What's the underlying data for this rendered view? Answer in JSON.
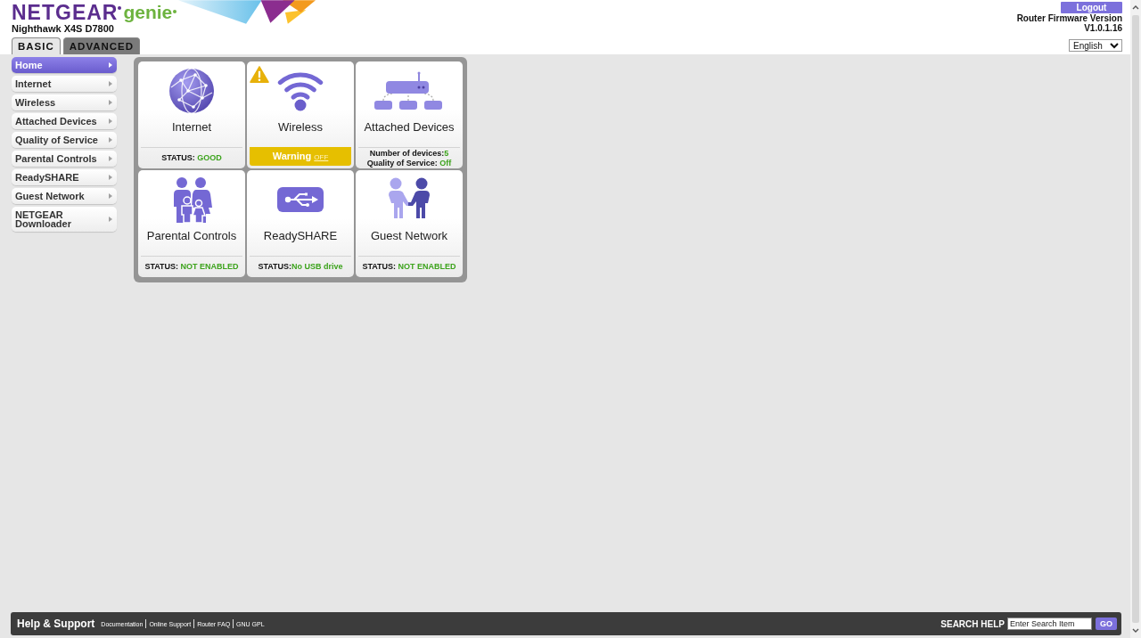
{
  "header": {
    "brand": "NETGEAR",
    "product": "genie",
    "model": "Nighthawk X4S D7800",
    "logout": "Logout",
    "firmware_label": "Router Firmware Version",
    "firmware_version": "V1.0.1.16",
    "language": "English"
  },
  "tabs": [
    {
      "label": "BASIC",
      "selected": true
    },
    {
      "label": "ADVANCED",
      "selected": false
    }
  ],
  "sidebar": {
    "items": [
      {
        "label": "Home",
        "selected": true
      },
      {
        "label": "Internet",
        "selected": false
      },
      {
        "label": "Wireless",
        "selected": false
      },
      {
        "label": "Attached Devices",
        "selected": false
      },
      {
        "label": "Quality of Service",
        "selected": false
      },
      {
        "label": "Parental Controls",
        "selected": false
      },
      {
        "label": "ReadySHARE",
        "selected": false
      },
      {
        "label": "Guest Network",
        "selected": false
      },
      {
        "label": "NETGEAR Downloader",
        "selected": false
      }
    ]
  },
  "tiles": [
    {
      "kind": "globe",
      "title": "Internet",
      "warning": false,
      "status": [
        {
          "label": "STATUS: ",
          "value": "GOOD"
        }
      ]
    },
    {
      "kind": "wifi",
      "title": "Wireless",
      "warning": true,
      "status": [
        {
          "label": "Warning ",
          "value": "OFF"
        }
      ]
    },
    {
      "kind": "router",
      "title": "Attached Devices",
      "warning": false,
      "status": [
        {
          "label": "Number of devices:",
          "value": "5"
        },
        {
          "label": "Quality of Service: ",
          "value": "Off"
        }
      ]
    },
    {
      "kind": "family",
      "title": "Parental Controls",
      "warning": false,
      "status": [
        {
          "label": "STATUS: ",
          "value": "NOT ENABLED"
        }
      ]
    },
    {
      "kind": "usb",
      "title": "ReadySHARE",
      "warning": false,
      "status": [
        {
          "label": "STATUS:",
          "value": "No USB drive"
        }
      ]
    },
    {
      "kind": "people",
      "title": "Guest Network",
      "warning": false,
      "status": [
        {
          "label": "STATUS: ",
          "value": "NOT ENABLED"
        }
      ]
    }
  ],
  "footer": {
    "title": "Help & Support",
    "links": [
      "Documentation",
      "Online Support",
      "Router FAQ",
      "GNU GPL"
    ],
    "search_label": "SEARCH HELP",
    "search": {
      "placeholder": "Enter Search Item"
    },
    "go": "GO"
  }
}
